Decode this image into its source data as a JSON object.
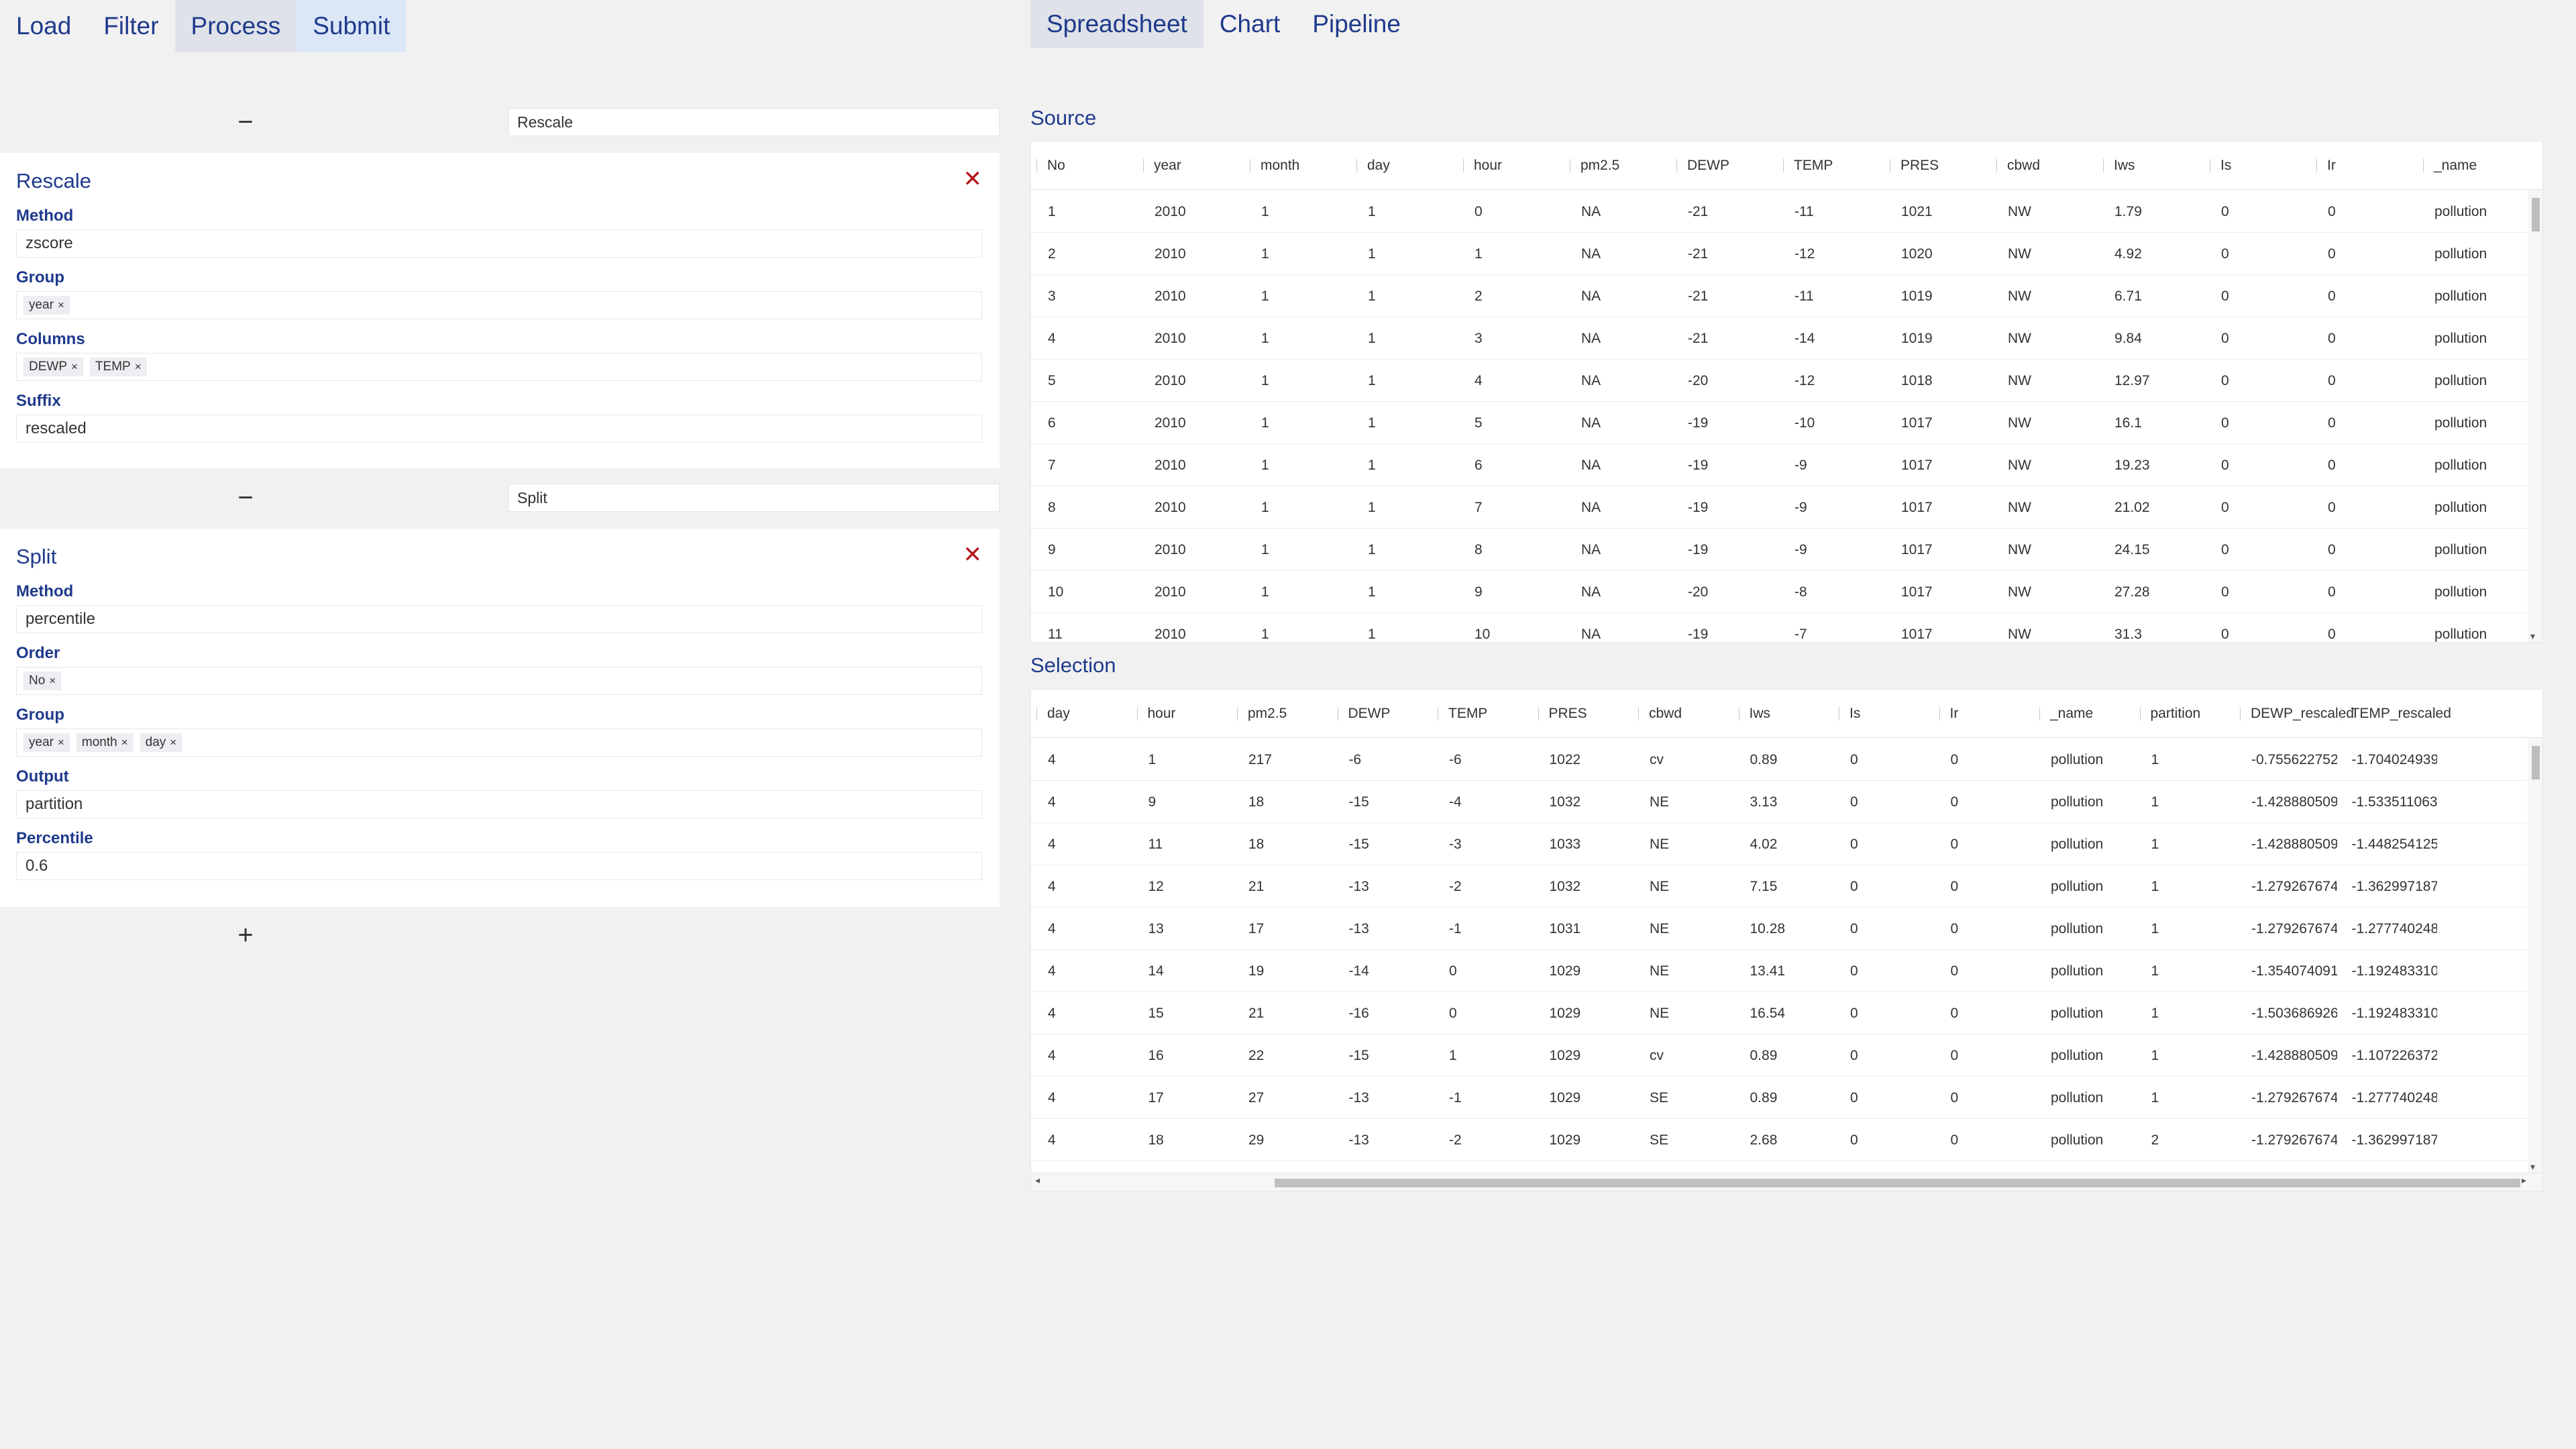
{
  "left_nav": {
    "tabs": [
      "Load",
      "Filter",
      "Process",
      "Submit"
    ]
  },
  "right_nav": {
    "tabs": [
      "Spreadsheet",
      "Chart",
      "Pipeline"
    ]
  },
  "pipeline": {
    "collapse_icon": "−",
    "add_icon": "+",
    "close_icon": "✕",
    "chip_remove": "×",
    "steps": [
      {
        "name": "Rescale",
        "title": "Rescale",
        "fields": [
          {
            "label": "Method",
            "value": "zscore"
          },
          {
            "label": "Group",
            "chips": [
              "year"
            ]
          },
          {
            "label": "Columns",
            "chips": [
              "DEWP",
              "TEMP"
            ]
          },
          {
            "label": "Suffix",
            "value": "rescaled"
          }
        ]
      },
      {
        "name": "Split",
        "title": "Split",
        "fields": [
          {
            "label": "Method",
            "value": "percentile"
          },
          {
            "label": "Order",
            "chips": [
              "No"
            ]
          },
          {
            "label": "Group",
            "chips": [
              "year",
              "month",
              "day"
            ]
          },
          {
            "label": "Output",
            "value": "partition"
          },
          {
            "label": "Percentile",
            "value": "0.6"
          }
        ]
      }
    ]
  },
  "source": {
    "title": "Source",
    "columns": [
      "No",
      "year",
      "month",
      "day",
      "hour",
      "pm2.5",
      "DEWP",
      "TEMP",
      "PRES",
      "cbwd",
      "Iws",
      "Is",
      "Ir",
      "_name"
    ],
    "rows": [
      [
        "1",
        "2010",
        "1",
        "1",
        "0",
        "NA",
        "-21",
        "-11",
        "1021",
        "NW",
        "1.79",
        "0",
        "0",
        "pollution"
      ],
      [
        "2",
        "2010",
        "1",
        "1",
        "1",
        "NA",
        "-21",
        "-12",
        "1020",
        "NW",
        "4.92",
        "0",
        "0",
        "pollution"
      ],
      [
        "3",
        "2010",
        "1",
        "1",
        "2",
        "NA",
        "-21",
        "-11",
        "1019",
        "NW",
        "6.71",
        "0",
        "0",
        "pollution"
      ],
      [
        "4",
        "2010",
        "1",
        "1",
        "3",
        "NA",
        "-21",
        "-14",
        "1019",
        "NW",
        "9.84",
        "0",
        "0",
        "pollution"
      ],
      [
        "5",
        "2010",
        "1",
        "1",
        "4",
        "NA",
        "-20",
        "-12",
        "1018",
        "NW",
        "12.97",
        "0",
        "0",
        "pollution"
      ],
      [
        "6",
        "2010",
        "1",
        "1",
        "5",
        "NA",
        "-19",
        "-10",
        "1017",
        "NW",
        "16.1",
        "0",
        "0",
        "pollution"
      ],
      [
        "7",
        "2010",
        "1",
        "1",
        "6",
        "NA",
        "-19",
        "-9",
        "1017",
        "NW",
        "19.23",
        "0",
        "0",
        "pollution"
      ],
      [
        "8",
        "2010",
        "1",
        "1",
        "7",
        "NA",
        "-19",
        "-9",
        "1017",
        "NW",
        "21.02",
        "0",
        "0",
        "pollution"
      ],
      [
        "9",
        "2010",
        "1",
        "1",
        "8",
        "NA",
        "-19",
        "-9",
        "1017",
        "NW",
        "24.15",
        "0",
        "0",
        "pollution"
      ],
      [
        "10",
        "2010",
        "1",
        "1",
        "9",
        "NA",
        "-20",
        "-8",
        "1017",
        "NW",
        "27.28",
        "0",
        "0",
        "pollution"
      ],
      [
        "11",
        "2010",
        "1",
        "1",
        "10",
        "NA",
        "-19",
        "-7",
        "1017",
        "NW",
        "31.3",
        "0",
        "0",
        "pollution"
      ]
    ]
  },
  "selection": {
    "title": "Selection",
    "columns": [
      "day",
      "hour",
      "pm2.5",
      "DEWP",
      "TEMP",
      "PRES",
      "cbwd",
      "Iws",
      "Is",
      "Ir",
      "_name",
      "partition",
      "DEWP_rescaled",
      "TEMP_rescaled"
    ],
    "rows": [
      [
        "4",
        "1",
        "217",
        "-6",
        "-6",
        "1022",
        "cv",
        "0.89",
        "0",
        "0",
        "pollution",
        "1",
        "-0.755622752...",
        "-1.704024939..."
      ],
      [
        "4",
        "9",
        "18",
        "-15",
        "-4",
        "1032",
        "NE",
        "3.13",
        "0",
        "0",
        "pollution",
        "1",
        "-1.428880509...",
        "-1.533511063..."
      ],
      [
        "4",
        "11",
        "18",
        "-15",
        "-3",
        "1033",
        "NE",
        "4.02",
        "0",
        "0",
        "pollution",
        "1",
        "-1.428880509...",
        "-1.448254125..."
      ],
      [
        "4",
        "12",
        "21",
        "-13",
        "-2",
        "1032",
        "NE",
        "7.15",
        "0",
        "0",
        "pollution",
        "1",
        "-1.279267674...",
        "-1.362997187..."
      ],
      [
        "4",
        "13",
        "17",
        "-13",
        "-1",
        "1031",
        "NE",
        "10.28",
        "0",
        "0",
        "pollution",
        "1",
        "-1.279267674...",
        "-1.277740248..."
      ],
      [
        "4",
        "14",
        "19",
        "-14",
        "0",
        "1029",
        "NE",
        "13.41",
        "0",
        "0",
        "pollution",
        "1",
        "-1.354074091...",
        "-1.192483310..."
      ],
      [
        "4",
        "15",
        "21",
        "-16",
        "0",
        "1029",
        "NE",
        "16.54",
        "0",
        "0",
        "pollution",
        "1",
        "-1.503686926...",
        "-1.192483310..."
      ],
      [
        "4",
        "16",
        "22",
        "-15",
        "1",
        "1029",
        "cv",
        "0.89",
        "0",
        "0",
        "pollution",
        "1",
        "-1.428880509...",
        "-1.107226372..."
      ],
      [
        "4",
        "17",
        "27",
        "-13",
        "-1",
        "1029",
        "SE",
        "0.89",
        "0",
        "0",
        "pollution",
        "1",
        "-1.279267674...",
        "-1.277740248..."
      ],
      [
        "4",
        "18",
        "29",
        "-13",
        "-2",
        "1029",
        "SE",
        "2.68",
        "0",
        "0",
        "pollution",
        "2",
        "-1.279267674...",
        "-1.362997187..."
      ]
    ]
  }
}
